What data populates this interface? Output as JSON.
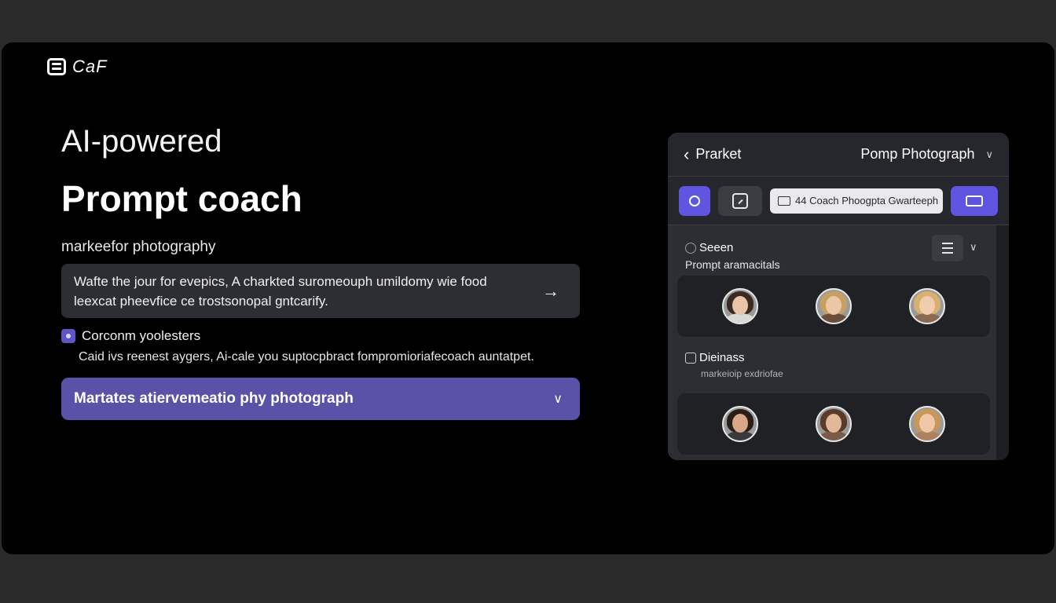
{
  "brand": {
    "logo_text": "CaF",
    "logo_icon": "logo-icon"
  },
  "hero": {
    "eyebrow": "AI-powered",
    "headline": "Prompt coach",
    "sublabel": "markeefor  photography"
  },
  "prompt": {
    "text": "Wafte the jour for evepics, A  charkted suromeouph umildomy wie food leexcat pheevfice ce trostsonopal gntcarify.",
    "submit_icon": "arrow-right-icon"
  },
  "note": {
    "title": "Corconm yoolesters",
    "description": "Caid ivs reenest aygers, Ai-cale you suptocpbract fompromioriafecoach auntatpet."
  },
  "select": {
    "value": "Martates atiervemeatio phy photograph",
    "icon": "chevron-down-icon"
  },
  "panel": {
    "back_label": "Prarket",
    "title": "Pomp Photograph",
    "toolbar": {
      "search_value": "44 Coach Phoogpta Gwarteeph"
    },
    "sections": [
      {
        "title": "Seeen",
        "subtitle": "Prompt aramacitals",
        "avatars": [
          {
            "hair": "#3b2a22",
            "face": "#e8c4a8",
            "shoulders": "#d9d9d9"
          },
          {
            "hair": "#c8a064",
            "face": "#eac7a5",
            "shoulders": "#6b4e3a"
          },
          {
            "hair": "#d8b070",
            "face": "#f0cdb0",
            "shoulders": "#8a6a50"
          }
        ]
      },
      {
        "title": "Dieinass",
        "subtitle": "markeioip exdriofae",
        "avatars": [
          {
            "hair": "#2a1e18",
            "face": "#d8a888",
            "shoulders": "#3a3a3a"
          },
          {
            "hair": "#5a3a2a",
            "face": "#e2b898",
            "shoulders": "#7a5a48"
          },
          {
            "hair": "#c89858",
            "face": "#eec8a8",
            "shoulders": "#b08060"
          }
        ]
      }
    ]
  },
  "colors": {
    "accent": "#5f55e0",
    "select_bg": "#5a51a8",
    "panel_bg": "#2c2e33"
  }
}
